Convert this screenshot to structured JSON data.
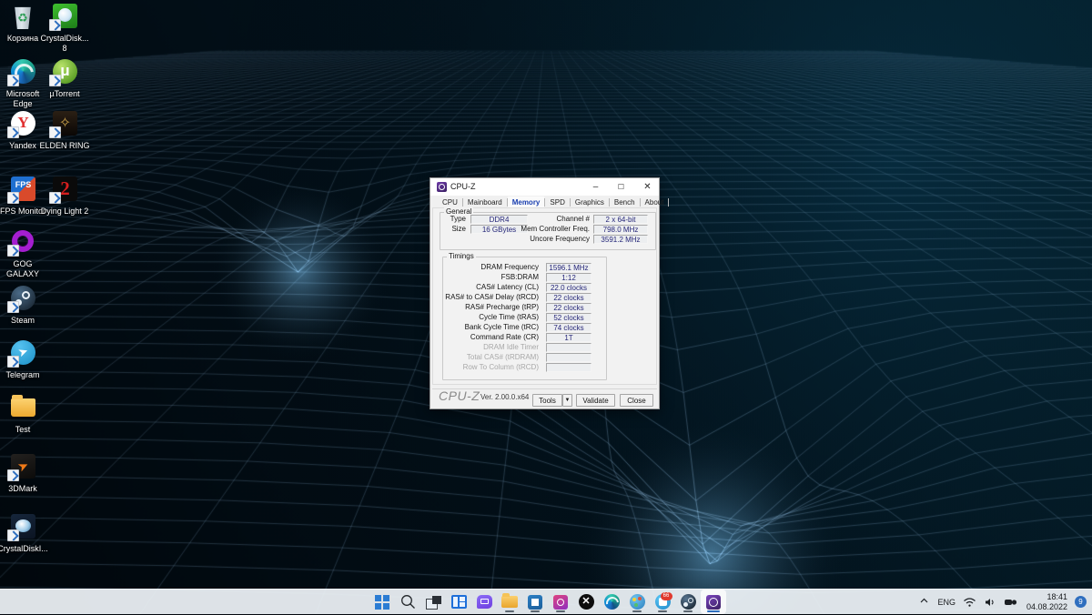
{
  "desktop": {
    "icons": [
      {
        "label": "Корзина",
        "icon": "recycle-bin-icon"
      },
      {
        "label": "CrystalDisk... 8",
        "icon": "crystaldiskinfo8-icon"
      },
      {
        "label": "Microsoft Edge",
        "icon": "microsoft-edge-icon"
      },
      {
        "label": "µTorrent",
        "icon": "utorrent-icon"
      },
      {
        "label": "Yandex",
        "icon": "yandex-browser-icon"
      },
      {
        "label": "ELDEN RING",
        "icon": "elden-ring-icon"
      },
      {
        "label": "FPS Monitor",
        "icon": "fps-monitor-icon"
      },
      {
        "label": "Dying Light 2",
        "icon": "dying-light-2-icon"
      },
      {
        "label": "GOG GALAXY",
        "icon": "gog-galaxy-icon"
      },
      {
        "label": "Steam",
        "icon": "steam-icon"
      },
      {
        "label": "Telegram",
        "icon": "telegram-icon"
      },
      {
        "label": "Test",
        "icon": "folder-icon"
      },
      {
        "label": "3DMark",
        "icon": "3dmark-icon"
      },
      {
        "label": "CrystalDiskI...",
        "icon": "crystaldiskinfo-icon"
      }
    ]
  },
  "cpuz": {
    "title": "CPU-Z",
    "window_buttons": {
      "minimize": "–",
      "maximize": "☐",
      "close": "✕"
    },
    "tabs": [
      {
        "label": "CPU"
      },
      {
        "label": "Mainboard"
      },
      {
        "label": "Memory"
      },
      {
        "label": "SPD"
      },
      {
        "label": "Graphics"
      },
      {
        "label": "Bench"
      },
      {
        "label": "About"
      }
    ],
    "general": {
      "legend": "General",
      "left": [
        {
          "label": "Type",
          "value": "DDR4"
        },
        {
          "label": "Size",
          "value": "16 GBytes"
        }
      ],
      "right": [
        {
          "label": "Channel #",
          "value": "2 x 64-bit"
        },
        {
          "label": "Mem Controller Freq.",
          "value": "798.0 MHz"
        },
        {
          "label": "Uncore Frequency",
          "value": "3591.2 MHz"
        }
      ]
    },
    "timings": {
      "legend": "Timings",
      "rows": [
        {
          "label": "DRAM Frequency",
          "value": "1596.1 MHz"
        },
        {
          "label": "FSB:DRAM",
          "value": "1:12"
        },
        {
          "label": "CAS# Latency (CL)",
          "value": "22.0 clocks"
        },
        {
          "label": "RAS# to CAS# Delay (tRCD)",
          "value": "22 clocks"
        },
        {
          "label": "RAS# Precharge (tRP)",
          "value": "22 clocks"
        },
        {
          "label": "Cycle Time (tRAS)",
          "value": "52 clocks"
        },
        {
          "label": "Bank Cycle Time (tRC)",
          "value": "74 clocks"
        },
        {
          "label": "Command Rate (CR)",
          "value": "1T"
        },
        {
          "label": "DRAM Idle Timer",
          "value": ""
        },
        {
          "label": "Total CAS# (tRDRAM)",
          "value": ""
        },
        {
          "label": "Row To Column (tRCD)",
          "value": ""
        }
      ]
    },
    "footer": {
      "brand": "CPU-Z",
      "version": "Ver. 2.00.0.x64",
      "tools": "Tools",
      "tools_arrow": "▼",
      "validate": "Validate",
      "close": "Close"
    }
  },
  "taskbar": {
    "items": [
      {
        "icon": "start-icon",
        "running": false
      },
      {
        "icon": "search-icon",
        "running": false
      },
      {
        "icon": "task-view-icon",
        "running": false
      },
      {
        "icon": "widgets-icon",
        "running": false
      },
      {
        "icon": "chat-icon",
        "running": false
      },
      {
        "icon": "file-explorer-icon",
        "running": true
      },
      {
        "icon": "microsoft-store-icon",
        "running": true
      },
      {
        "icon": "pinned-app-icon",
        "running": true
      },
      {
        "icon": "xbox-icon",
        "running": false,
        "glyph": "✕"
      },
      {
        "icon": "microsoft-edge-icon",
        "running": false
      },
      {
        "icon": "paint-icon",
        "running": true
      },
      {
        "icon": "messenger-icon",
        "running": true,
        "badge": "66"
      },
      {
        "icon": "steam-icon",
        "running": true
      },
      {
        "icon": "cpuz-icon",
        "running": true,
        "active": true
      }
    ],
    "tray": {
      "overflow": "⌃",
      "language": "ENG",
      "wifi": "wifi-icon",
      "volume": "volume-icon",
      "webcam": "webcam-icon",
      "time": "18:41",
      "date": "04.08.2022",
      "notifications": "9"
    }
  }
}
